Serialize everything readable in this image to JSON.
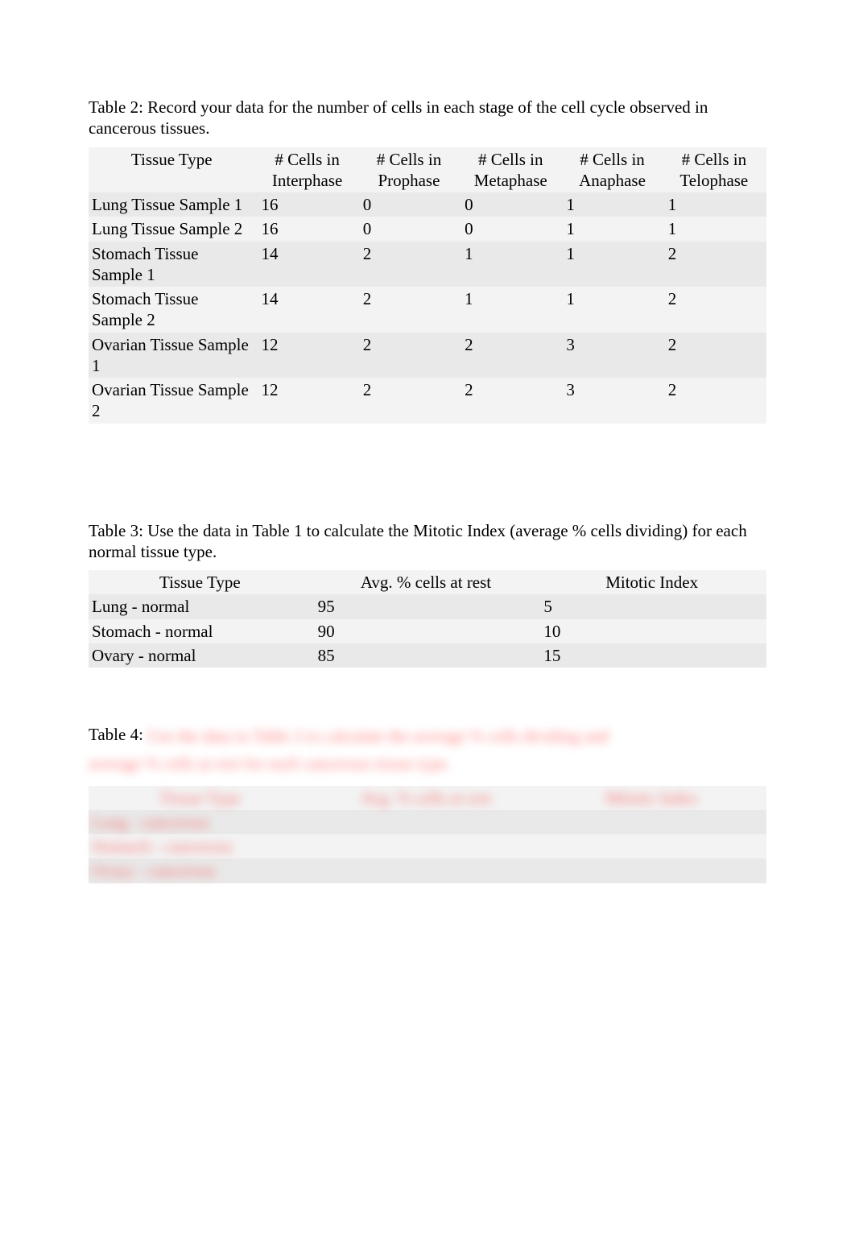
{
  "table2": {
    "caption_label": "Table 2:   ",
    "caption_text": "Record your data for the number of cells in each stage of the cell cycle observed in cancerous tissues.",
    "headers": {
      "c0": "Tissue Type",
      "c1": "# Cells in Interphase",
      "c2": "# Cells in Prophase",
      "c3": "# Cells in Metaphase",
      "c4": "# Cells in Anaphase",
      "c5": "# Cells in Telophase"
    },
    "rows": [
      {
        "tissue": "Lung Tissue Sample 1",
        "interphase": "16",
        "prophase": "0",
        "metaphase": "0",
        "anaphase": "1",
        "telophase": "1"
      },
      {
        "tissue": "Lung Tissue Sample 2",
        "interphase": "16",
        "prophase": "0",
        "metaphase": "0",
        "anaphase": "1",
        "telophase": "1"
      },
      {
        "tissue": "Stomach Tissue Sample 1",
        "interphase": "14",
        "prophase": "2",
        "metaphase": "1",
        "anaphase": "1",
        "telophase": "2"
      },
      {
        "tissue": "Stomach Tissue Sample 2",
        "interphase": "14",
        "prophase": "2",
        "metaphase": "1",
        "anaphase": "1",
        "telophase": "2"
      },
      {
        "tissue": "Ovarian Tissue Sample 1",
        "interphase": "12",
        "prophase": "2",
        "metaphase": "2",
        "anaphase": "3",
        "telophase": "2"
      },
      {
        "tissue": "Ovarian Tissue Sample 2",
        "interphase": "12",
        "prophase": "2",
        "metaphase": "2",
        "anaphase": "3",
        "telophase": "2"
      }
    ]
  },
  "table3": {
    "caption_label": "Table 3:   ",
    "caption_text": "Use the data in Table 1 to calculate the Mitotic Index (average % cells dividing) for each normal tissue type.",
    "headers": {
      "c0": "Tissue Type",
      "c1": "Avg. % cells at rest",
      "c2": "Mitotic Index"
    },
    "rows": [
      {
        "tissue": "Lung - normal",
        "rest": "95",
        "mi": "5"
      },
      {
        "tissue": "Stomach - normal",
        "rest": "90",
        "mi": "10"
      },
      {
        "tissue": "Ovary - normal",
        "rest": "85",
        "mi": "15"
      }
    ]
  },
  "table4": {
    "caption_label": "Table 4:   ",
    "redacted_line1": "Use the data in Table 2 to calculate the average % cells dividing and",
    "redacted_line2": "average % cells at rest for each cancerous tissue type.",
    "headers": {
      "c0": "Tissue Type",
      "c1": "Avg. % cells at rest",
      "c2": "Mitotic Index"
    },
    "rows": [
      {
        "tissue": "Lung - cancerous",
        "rest": "",
        "mi": ""
      },
      {
        "tissue": "Stomach - cancerous",
        "rest": "",
        "mi": ""
      },
      {
        "tissue": "Ovary - cancerous",
        "rest": "",
        "mi": ""
      }
    ]
  }
}
